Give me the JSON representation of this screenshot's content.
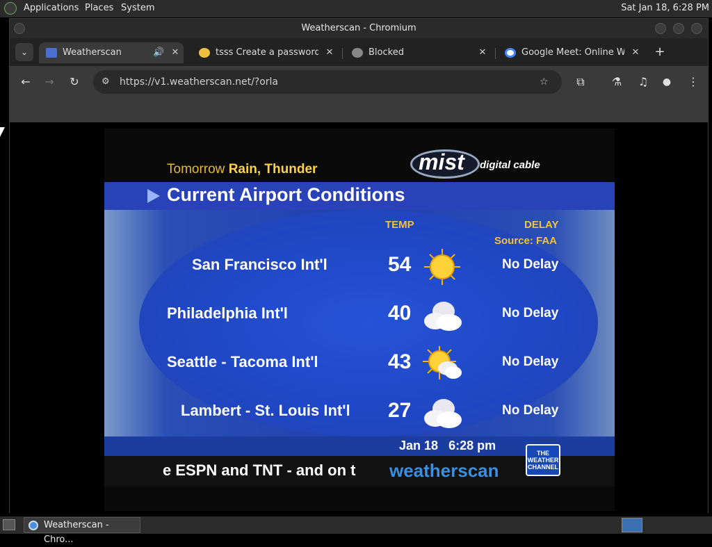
{
  "desktop": {
    "menus": [
      "Applications",
      "Places",
      "System"
    ],
    "clock": "Sat Jan 18,  6:28 PM"
  },
  "window": {
    "title": "Weatherscan - Chromium"
  },
  "tabs": [
    {
      "label": "Weatherscan",
      "active": true
    },
    {
      "label": "tsss Create a password-p",
      "active": false
    },
    {
      "label": "Blocked",
      "active": false
    },
    {
      "label": "Google Meet: Online Web",
      "active": false
    }
  ],
  "address_bar": {
    "url": "https://v1.weatherscan.net/?orla"
  },
  "weatherscan": {
    "tomorrow_prefix": "Tomorrow",
    "tomorrow_forecast": "Rain, Thunder",
    "brand": "mist",
    "brand_sub": "digital cable",
    "section_title": "Current Airport Conditions",
    "col_temp": "TEMP",
    "col_delay": "DELAY",
    "source": "Source: FAA",
    "airports": [
      {
        "name": "San Francisco Int'l",
        "temp": "54",
        "icon": "sunny-icon",
        "delay": "No Delay"
      },
      {
        "name": "Philadelphia Int'l",
        "temp": "40",
        "icon": "cloudy-icon",
        "delay": "No Delay"
      },
      {
        "name": "Seattle - Tacoma Int'l",
        "temp": "43",
        "icon": "partly-cloudy-icon",
        "delay": "No Delay"
      },
      {
        "name": "Lambert - St. Louis Int'l",
        "temp": "27",
        "icon": "cloudy-icon",
        "delay": "No Delay"
      }
    ],
    "date": "Jan 18",
    "time": "6:28 pm",
    "ticker": "e ESPN and TNT - and on t",
    "logo_text": "weatherscan",
    "twc_logo": "THE WEATHER CHANNEL"
  },
  "taskbar": {
    "item": "Weatherscan - Chro..."
  },
  "colors": {
    "panel_blue": "#1f3fae",
    "header_gold": "#f3c23a",
    "tomorrow_gold": "#e8b830"
  }
}
